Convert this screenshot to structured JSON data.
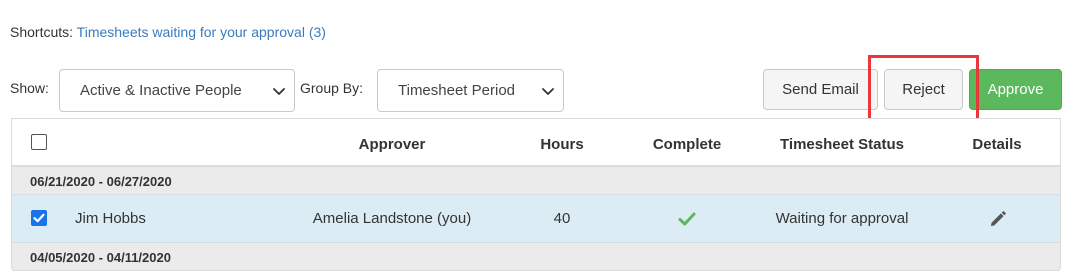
{
  "shortcuts": {
    "label": "Shortcuts:",
    "link": "Timesheets waiting for your approval (3)"
  },
  "filters": {
    "show_label": "Show:",
    "show_value": "Active & Inactive People",
    "group_label": "Group By:",
    "group_value": "Timesheet Period"
  },
  "actions": {
    "send_email": "Send Email",
    "reject": "Reject",
    "approve": "Approve"
  },
  "table": {
    "headers": {
      "approver": "Approver",
      "hours": "Hours",
      "complete": "Complete",
      "status": "Timesheet Status",
      "details": "Details"
    },
    "groups": [
      {
        "period": "06/21/2020 - 06/27/2020",
        "rows": [
          {
            "name": "Jim Hobbs",
            "approver": "Amelia Landstone (you)",
            "hours": "40",
            "complete": true,
            "status": "Waiting for approval",
            "selected": true
          }
        ]
      },
      {
        "period": "04/05/2020 - 04/11/2020",
        "rows": []
      }
    ]
  },
  "colors": {
    "link": "#3a7bbf",
    "approve": "#5cb85c",
    "highlight": "#e8383d",
    "selected_row": "#dcecf4",
    "checkbox_checked": "#1a73e8"
  },
  "icons": {
    "complete": "check-icon",
    "details": "pencil-icon",
    "select": "chevron-down-icon"
  }
}
